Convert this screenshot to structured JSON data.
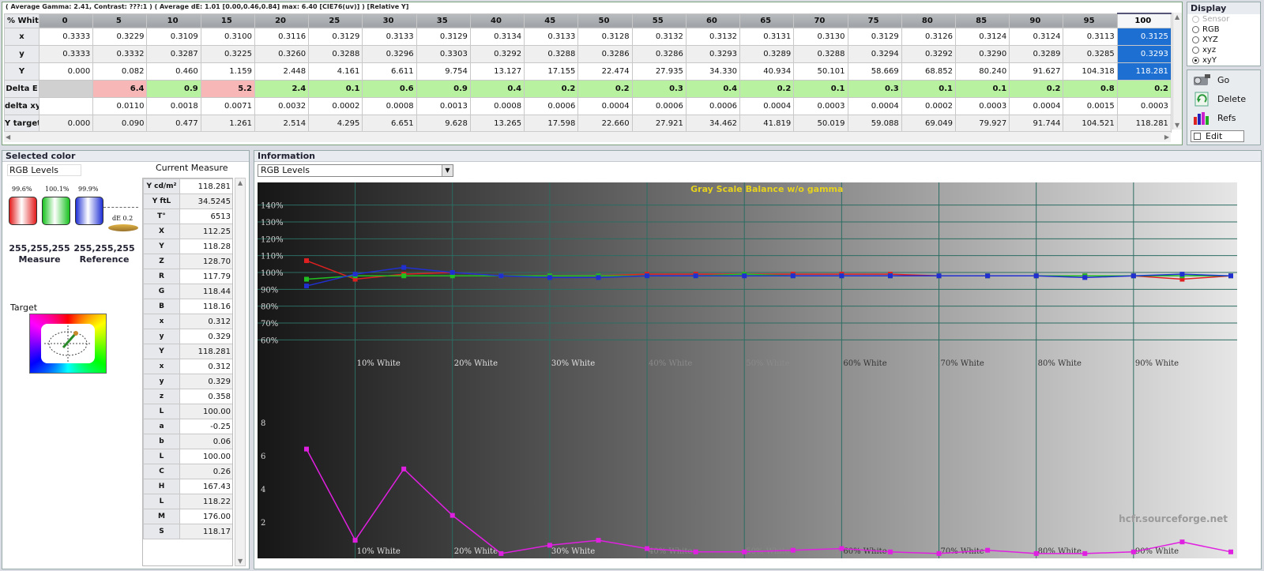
{
  "summary": "( Average Gamma: 2.41, Contrast: ???:1 ) ( Average dE: 1.01 [0.00,0.46,0.84] max: 6.40 [CIE76(uv)] ) [Relative Y]",
  "grid": {
    "corner": "% White",
    "columns": [
      "0",
      "5",
      "10",
      "15",
      "20",
      "25",
      "30",
      "35",
      "40",
      "45",
      "50",
      "55",
      "60",
      "65",
      "70",
      "75",
      "80",
      "85",
      "90",
      "95",
      "100"
    ],
    "selected_column": 20,
    "rows": [
      {
        "label": "x",
        "values": [
          "0.3333",
          "0.3229",
          "0.3109",
          "0.3100",
          "0.3116",
          "0.3129",
          "0.3133",
          "0.3129",
          "0.3134",
          "0.3133",
          "0.3128",
          "0.3132",
          "0.3132",
          "0.3131",
          "0.3130",
          "0.3129",
          "0.3126",
          "0.3124",
          "0.3124",
          "0.3113",
          "0.3125"
        ]
      },
      {
        "label": "y",
        "values": [
          "0.3333",
          "0.3332",
          "0.3287",
          "0.3225",
          "0.3260",
          "0.3288",
          "0.3296",
          "0.3303",
          "0.3292",
          "0.3288",
          "0.3286",
          "0.3286",
          "0.3293",
          "0.3289",
          "0.3288",
          "0.3294",
          "0.3292",
          "0.3290",
          "0.3289",
          "0.3285",
          "0.3293"
        ]
      },
      {
        "label": "Y",
        "values": [
          "0.000",
          "0.082",
          "0.460",
          "1.159",
          "2.448",
          "4.161",
          "6.611",
          "9.754",
          "13.127",
          "17.155",
          "22.474",
          "27.935",
          "34.330",
          "40.934",
          "50.101",
          "58.669",
          "68.852",
          "80.240",
          "91.627",
          "104.318",
          "118.281"
        ]
      },
      {
        "label": "Delta E",
        "values": [
          "",
          "6.4",
          "0.9",
          "5.2",
          "2.4",
          "0.1",
          "0.6",
          "0.9",
          "0.4",
          "0.2",
          "0.2",
          "0.3",
          "0.4",
          "0.2",
          "0.1",
          "0.3",
          "0.1",
          "0.1",
          "0.2",
          "0.8",
          "0.2"
        ]
      },
      {
        "label": "delta xy",
        "values": [
          "",
          "0.0110",
          "0.0018",
          "0.0071",
          "0.0032",
          "0.0002",
          "0.0008",
          "0.0013",
          "0.0008",
          "0.0006",
          "0.0004",
          "0.0006",
          "0.0006",
          "0.0004",
          "0.0003",
          "0.0004",
          "0.0002",
          "0.0003",
          "0.0004",
          "0.0015",
          "0.0003"
        ]
      },
      {
        "label": "Y target",
        "values": [
          "0.000",
          "0.090",
          "0.477",
          "1.261",
          "2.514",
          "4.295",
          "6.651",
          "9.628",
          "13.265",
          "17.598",
          "22.660",
          "27.921",
          "34.462",
          "41.819",
          "50.019",
          "59.088",
          "69.049",
          "79.927",
          "91.744",
          "104.521",
          "118.281"
        ]
      }
    ]
  },
  "display": {
    "title": "Display",
    "options": [
      {
        "label": "Sensor",
        "state": "disabled"
      },
      {
        "label": "RGB",
        "state": ""
      },
      {
        "label": "XYZ",
        "state": ""
      },
      {
        "label": "xyz",
        "state": ""
      },
      {
        "label": "xyY",
        "state": "checked"
      }
    ]
  },
  "buttons": {
    "go": "Go",
    "delete": "Delete",
    "refs": "Refs",
    "edit": "Edit"
  },
  "selected_color": {
    "title": "Selected color",
    "mode": "RGB Levels",
    "current_measure": "Current Measure",
    "bars": [
      {
        "label": "99.6%",
        "color": "#e31b1b",
        "level": 99.6
      },
      {
        "label": "100.1%",
        "color": "#19c21f",
        "level": 100.1
      },
      {
        "label": "99.9%",
        "color": "#1f2fd4",
        "level": 99.9
      }
    ],
    "de_label": "dE 0.2",
    "measure_rgb": "255,255,255",
    "measure_label": "Measure",
    "reference_rgb": "255,255,255",
    "reference_label": "Reference",
    "target_label": "Target",
    "table": [
      {
        "k": "Y cd/m²",
        "v": "118.281"
      },
      {
        "k": "Y ftL",
        "v": "34.5245"
      },
      {
        "k": "T°",
        "v": "6513"
      },
      {
        "k": "X",
        "v": "112.25"
      },
      {
        "k": "Y",
        "v": "118.28"
      },
      {
        "k": "Z",
        "v": "128.70"
      },
      {
        "k": "R",
        "v": "117.79"
      },
      {
        "k": "G",
        "v": "118.44"
      },
      {
        "k": "B",
        "v": "118.16"
      },
      {
        "k": "x",
        "v": "0.312"
      },
      {
        "k": "y",
        "v": "0.329"
      },
      {
        "k": "Y",
        "v": "118.281"
      },
      {
        "k": "x",
        "v": "0.312"
      },
      {
        "k": "y",
        "v": "0.329"
      },
      {
        "k": "z",
        "v": "0.358"
      },
      {
        "k": "L",
        "v": "100.00"
      },
      {
        "k": "a",
        "v": "-0.25"
      },
      {
        "k": "b",
        "v": "0.06"
      },
      {
        "k": "L",
        "v": "100.00"
      },
      {
        "k": "C",
        "v": "0.26"
      },
      {
        "k": "H",
        "v": "167.43"
      },
      {
        "k": "L",
        "v": "118.22"
      },
      {
        "k": "M",
        "v": "176.00"
      },
      {
        "k": "S",
        "v": "118.17"
      }
    ]
  },
  "information": {
    "title": "Information",
    "select_value": "RGB Levels",
    "watermark": "hcfr.sourceforge.net"
  },
  "chart_data": {
    "type": "line",
    "title": "Gray Scale Balance w/o gamma",
    "x": [
      5,
      10,
      15,
      20,
      25,
      30,
      35,
      40,
      45,
      50,
      55,
      60,
      65,
      70,
      75,
      80,
      85,
      90,
      95,
      100
    ],
    "x_tick_labels": [
      "10% White",
      "20% White",
      "30% White",
      "40% White",
      "50% White",
      "60% White",
      "70% White",
      "80% White",
      "90% White"
    ],
    "upper": {
      "y_tick_labels": [
        "140%",
        "130%",
        "120%",
        "110%",
        "100%",
        "90%",
        "80%",
        "70%",
        "60%"
      ],
      "ylim": [
        55,
        145
      ],
      "series": [
        {
          "color": "#e02020",
          "values": [
            107,
            96,
            99,
            100,
            98,
            98,
            98,
            99,
            99,
            99,
            99,
            99,
            99,
            98,
            98,
            98,
            98,
            98,
            96,
            98
          ]
        },
        {
          "color": "#20c020",
          "values": [
            96,
            98,
            98,
            98,
            98,
            98,
            98,
            98,
            98,
            99,
            98,
            98,
            98,
            98,
            98,
            98,
            98,
            98,
            98,
            98
          ]
        },
        {
          "color": "#2030d0",
          "values": [
            92,
            99,
            103,
            100,
            98,
            97,
            97,
            98,
            98,
            98,
            98,
            98,
            98,
            98,
            98,
            98,
            97,
            98,
            99,
            98
          ]
        }
      ]
    },
    "lower": {
      "y_tick_labels": [
        "8",
        "6",
        "4",
        "2"
      ],
      "ylim": [
        0,
        10
      ],
      "series": [
        {
          "color": "#e020e0",
          "values": [
            6.4,
            0.9,
            5.2,
            2.4,
            0.1,
            0.6,
            0.9,
            0.4,
            0.2,
            0.2,
            0.3,
            0.4,
            0.2,
            0.1,
            0.3,
            0.1,
            0.1,
            0.2,
            0.8,
            0.2
          ]
        }
      ]
    }
  }
}
